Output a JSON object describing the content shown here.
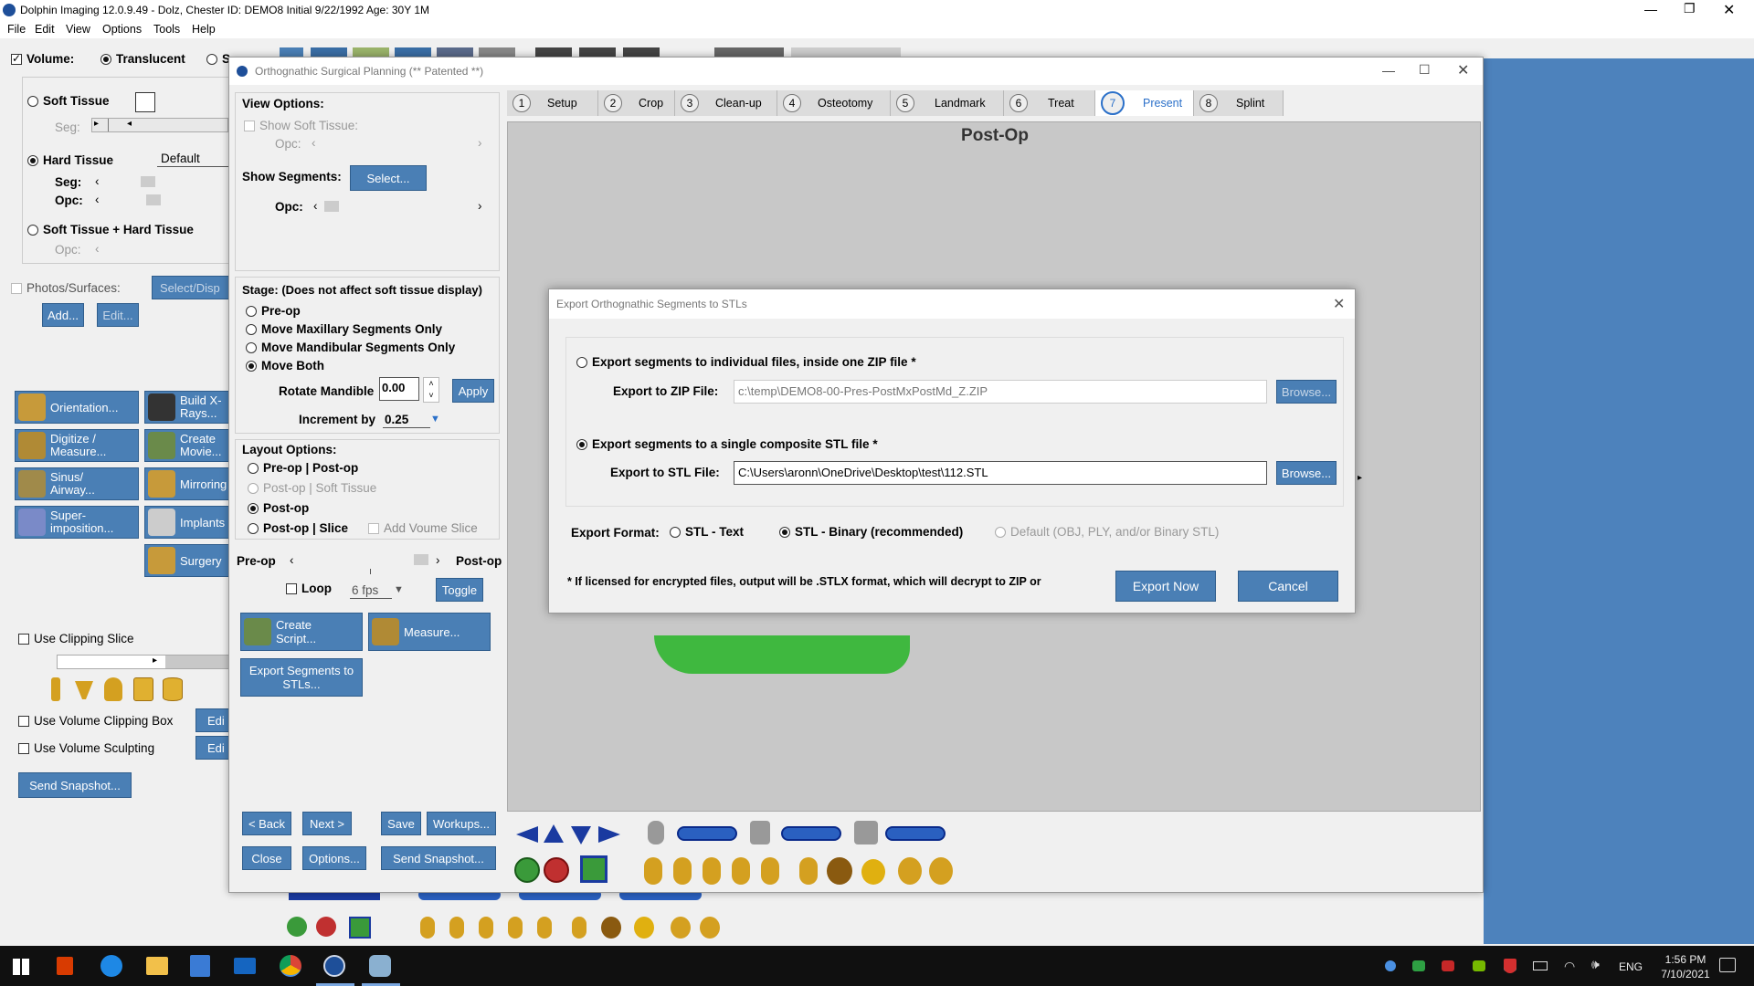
{
  "app": {
    "title": "Dolphin Imaging 12.0.9.49 - Dolz, Chester  ID: DEMO8 Initial 9/22/1992 Age: 30Y 1M",
    "menu": [
      "File",
      "Edit",
      "View",
      "Options",
      "Tools",
      "Help"
    ]
  },
  "left_panel": {
    "volume_label": "Volume:",
    "translucent_label": "Translucent",
    "solid_label": "S",
    "soft_tissue_label": "Soft Tissue",
    "seg_label": "Seg:",
    "hard_tissue_label": "Hard Tissue",
    "default_label": "Default",
    "seg2_label": "Seg:",
    "opc_label": "Opc:",
    "soft_hard_label": "Soft Tissue + Hard Tissue",
    "opc2_label": "Opc:",
    "photos_label": "Photos/Surfaces:",
    "select_disp_label": "Select/Disp",
    "add_label": "Add...",
    "edit_label": "Edit...",
    "tools": [
      "Orientation...",
      "Build X-Rays...",
      "Digitize / Measure...",
      "Create Movie...",
      "Sinus/ Airway...",
      "Mirroring",
      "Super- imposition...",
      "Implants",
      "Surgery"
    ],
    "clipping_slice_label": "Use Clipping Slice",
    "clipping_box_label": "Use Volume Clipping Box",
    "sculpting_label": "Use Volume Sculpting",
    "edit_short": "Edi",
    "send_snapshot_label": "Send Snapshot..."
  },
  "dialog": {
    "title": "Orthognathic Surgical Planning (** Patented **)",
    "view_options_label": "View Options:",
    "show_soft_tissue_label": "Show Soft Tissue:",
    "opc_label": "Opc:",
    "show_segments_label": "Show Segments:",
    "select_button": "Select...",
    "stage_label": "Stage: (Does not affect soft tissue display)",
    "stage_options": [
      "Pre-op",
      "Move Maxillary Segments Only",
      "Move Mandibular Segments Only",
      "Move Both"
    ],
    "rotate_mandible_label": "Rotate Mandible",
    "rotate_value": "0.00",
    "apply_button": "Apply",
    "increment_label": "Increment by",
    "increment_value": "0.25",
    "layout_options_label": "Layout Options:",
    "layout_options": [
      "Pre-op | Post-op",
      "Post-op | Soft Tissue",
      "Post-op",
      "Post-op | Slice"
    ],
    "add_volume_slice_label": "Add Voume Slice",
    "preop_label": "Pre-op",
    "postop_label": "Post-op",
    "loop_label": "Loop",
    "fps_value": "6 fps",
    "toggle_button": "Toggle",
    "create_script_button": "Create Script...",
    "measure_button": "Measure...",
    "export_segments_button": "Export Segments to STLs...",
    "back_button": "< Back",
    "next_button": "Next >",
    "save_button": "Save",
    "workups_button": "Workups...",
    "close_button": "Close",
    "options_button": "Options...",
    "send_snapshot_button": "Send Snapshot...",
    "steps": [
      {
        "num": "1",
        "label": "Setup"
      },
      {
        "num": "2",
        "label": "Crop"
      },
      {
        "num": "3",
        "label": "Clean-up"
      },
      {
        "num": "4",
        "label": "Osteotomy"
      },
      {
        "num": "5",
        "label": "Landmark"
      },
      {
        "num": "6",
        "label": "Treat"
      },
      {
        "num": "7",
        "label": "Present"
      },
      {
        "num": "8",
        "label": "Splint"
      }
    ],
    "viewport_title": "Post-Op"
  },
  "export_dialog": {
    "title": "Export Orthognathic Segments to STLs",
    "option_zip_label": "Export segments to individual files, inside one ZIP file *",
    "zip_file_label": "Export to ZIP File:",
    "zip_file_value": "c:\\temp\\DEMO8-00-Pres-PostMxPostMd_Z.ZIP",
    "browse_label": "Browse...",
    "option_stl_label": "Export segments to a single composite STL file *",
    "stl_file_label": "Export to STL File:",
    "stl_file_value": "C:\\Users\\aronn\\OneDrive\\Desktop\\test\\112.STL",
    "export_format_label": "Export Format:",
    "format_options": [
      "STL - Text",
      "STL - Binary (recommended)",
      "Default (OBJ, PLY, and/or Binary STL)"
    ],
    "footnote": "* If licensed for encrypted files, output will be .STLX format, which will decrypt to ZIP or",
    "export_now_button": "Export Now",
    "cancel_button": "Cancel"
  },
  "taskbar": {
    "language": "ENG",
    "time": "1:56 PM",
    "date": "7/10/2021"
  },
  "colors": {
    "button_blue": "#4a7fb5",
    "right_bg": "#4d82bc",
    "viewport_gray": "#c8c8c8",
    "model_green": "#3fb83f",
    "taskbar": "#101010"
  }
}
